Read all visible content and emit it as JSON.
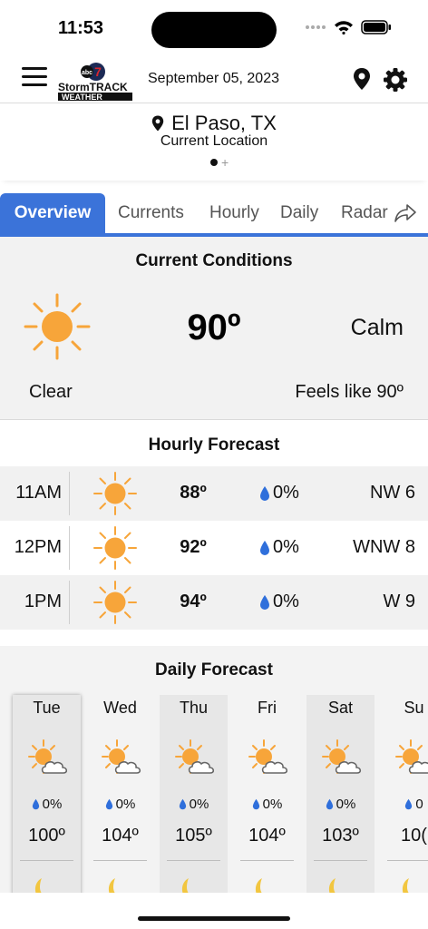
{
  "status_bar": {
    "time": "11:53"
  },
  "header": {
    "logo_top": "StormTRACK",
    "logo_bottom": "WEATHER",
    "logo_badge": "abc 7",
    "date": "September 05, 2023"
  },
  "location": {
    "city": "El Paso, TX",
    "subtitle": "Current Location",
    "pager_plus": "+"
  },
  "tabs": [
    "Overview",
    "Currents",
    "Hourly",
    "Daily",
    "Radar"
  ],
  "current": {
    "title": "Current Conditions",
    "temp": "90º",
    "wind": "Calm",
    "condition": "Clear",
    "feels_like": "Feels like 90º",
    "icon": "sun-icon"
  },
  "hourly": {
    "title": "Hourly Forecast",
    "rows": [
      {
        "time": "11AM",
        "temp": "88º",
        "precip": "0%",
        "wind": "NW 6",
        "icon": "sun-icon"
      },
      {
        "time": "12PM",
        "temp": "92º",
        "precip": "0%",
        "wind": "WNW 8",
        "icon": "sun-icon"
      },
      {
        "time": "1PM",
        "temp": "94º",
        "precip": "0%",
        "wind": "W 9",
        "icon": "sun-icon"
      }
    ]
  },
  "daily": {
    "title": "Daily Forecast",
    "days": [
      {
        "name": "Tue",
        "precip": "0%",
        "high": "100º",
        "icon": "partly-cloudy-icon"
      },
      {
        "name": "Wed",
        "precip": "0%",
        "high": "104º",
        "icon": "partly-cloudy-icon"
      },
      {
        "name": "Thu",
        "precip": "0%",
        "high": "105º",
        "icon": "partly-cloudy-icon"
      },
      {
        "name": "Fri",
        "precip": "0%",
        "high": "104º",
        "icon": "partly-cloudy-icon"
      },
      {
        "name": "Sat",
        "precip": "0%",
        "high": "103º",
        "icon": "partly-cloudy-icon"
      },
      {
        "name": "Su",
        "precip": "0",
        "high": "10(",
        "icon": "partly-cloudy-icon"
      }
    ]
  },
  "colors": {
    "accent": "#3b73d9",
    "sun": "#f7a53a",
    "drop": "#2f6fdb"
  }
}
